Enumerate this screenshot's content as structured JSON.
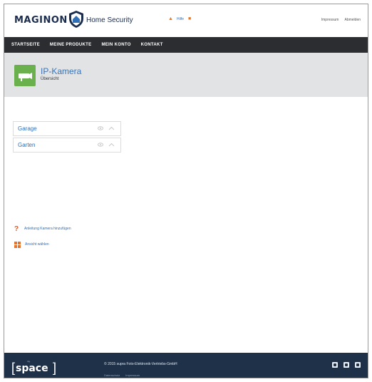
{
  "header": {
    "brand": "MAGINON",
    "product": "Home Security",
    "links": [
      "Hilfe"
    ],
    "right_links": [
      "Impressum",
      "Abmelden"
    ]
  },
  "nav": {
    "items": [
      "Startseite",
      "Meine Produkte",
      "Mein Konto",
      "Kontakt"
    ]
  },
  "page": {
    "title": "IP-Kamera",
    "subtitle": "Übersicht"
  },
  "cameras": [
    {
      "name": "Garage"
    },
    {
      "name": "Garten"
    }
  ],
  "help_links": [
    {
      "icon": "question-icon",
      "label": "Anleitung Kamera hinzufügen"
    },
    {
      "icon": "grid-icon",
      "label": "Ansicht wählen"
    }
  ],
  "footer": {
    "logo_small": "my",
    "logo": "space",
    "copyright": "© 2015 supra Foto-Elektronik-Vertriebs-GmbH",
    "links": [
      "Datenschutz",
      "Impressum"
    ],
    "social": [
      "facebook-icon",
      "youtube-icon",
      "twitter-icon"
    ]
  },
  "colors": {
    "nav_bg": "#2b2d30",
    "footer_bg": "#1f3148",
    "link": "#2e6fb8",
    "accent": "#e8732c",
    "camera_icon": "#6ab04c"
  }
}
